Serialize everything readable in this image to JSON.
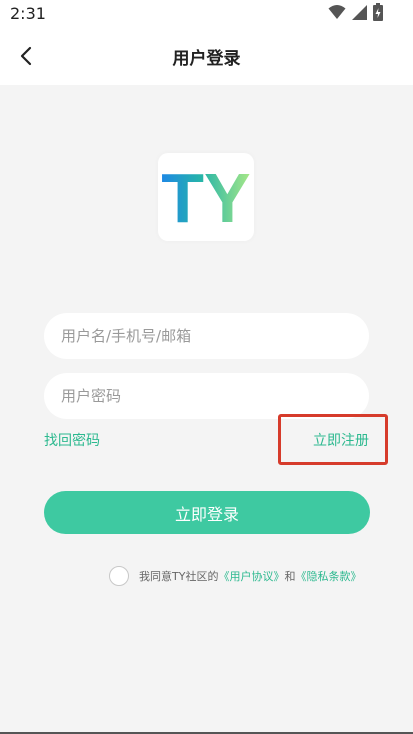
{
  "status_bar": {
    "time": "2:31",
    "icons": [
      "wifi-icon",
      "signal-icon",
      "battery-icon"
    ]
  },
  "header": {
    "title": "用户登录",
    "back_icon": "chevron-left-icon"
  },
  "logo": {
    "text": "TY",
    "colors": [
      "#1e88e5",
      "#a5e887"
    ]
  },
  "form": {
    "username_placeholder": "用户名/手机号/邮箱",
    "username_value": "",
    "password_placeholder": "用户密码",
    "password_value": ""
  },
  "links": {
    "forgot_password": "找回密码",
    "register": "立即注册"
  },
  "login_button": "立即登录",
  "agreement": {
    "checked": false,
    "prefix": "我同意TY社区的",
    "user_agreement": "《用户协议》",
    "conjunction": "和",
    "privacy_policy": "《隐私条款》"
  },
  "colors": {
    "accent": "#3ec9a1",
    "link": "#2cb98f",
    "highlight": "#d63b2b",
    "background": "#f4f4f4"
  }
}
